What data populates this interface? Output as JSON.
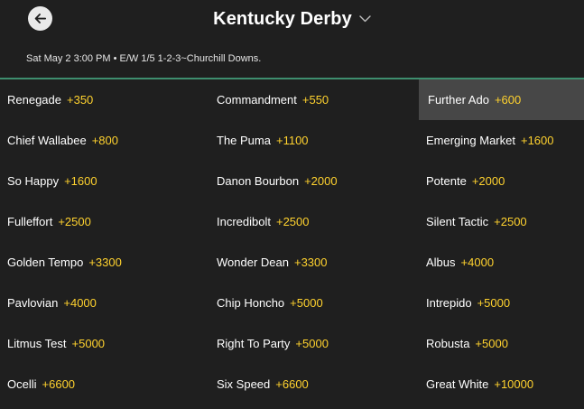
{
  "header": {
    "title": "Kentucky Derby",
    "subtitle": "Sat May 2 3:00 PM • E/W 1/5 1-2-3~Churchill Downs.",
    "back_icon": "arrow-left-icon",
    "dropdown_icon": "chevron-down-icon"
  },
  "colors": {
    "background": "#1f1f1f",
    "divider": "#3e8e6e",
    "odds": "#ffd22e",
    "selected_cell": "#474747"
  },
  "runners": [
    {
      "name": "Renegade",
      "odds": "+350"
    },
    {
      "name": "Commandment",
      "odds": "+550"
    },
    {
      "name": "Further Ado",
      "odds": "+600",
      "selected": true
    },
    {
      "name": "Chief Wallabee",
      "odds": "+800"
    },
    {
      "name": "The Puma",
      "odds": "+1100"
    },
    {
      "name": "Emerging Market",
      "odds": "+1600"
    },
    {
      "name": "So Happy",
      "odds": "+1600"
    },
    {
      "name": "Danon Bourbon",
      "odds": "+2000"
    },
    {
      "name": "Potente",
      "odds": "+2000"
    },
    {
      "name": "Fulleffort",
      "odds": "+2500"
    },
    {
      "name": "Incredibolt",
      "odds": "+2500"
    },
    {
      "name": "Silent Tactic",
      "odds": "+2500"
    },
    {
      "name": "Golden Tempo",
      "odds": "+3300"
    },
    {
      "name": "Wonder Dean",
      "odds": "+3300"
    },
    {
      "name": "Albus",
      "odds": "+4000"
    },
    {
      "name": "Pavlovian",
      "odds": "+4000"
    },
    {
      "name": "Chip Honcho",
      "odds": "+5000"
    },
    {
      "name": "Intrepido",
      "odds": "+5000"
    },
    {
      "name": "Litmus Test",
      "odds": "+5000"
    },
    {
      "name": "Right To Party",
      "odds": "+5000"
    },
    {
      "name": "Robusta",
      "odds": "+5000"
    },
    {
      "name": "Ocelli",
      "odds": "+6600"
    },
    {
      "name": "Six Speed",
      "odds": "+6600"
    },
    {
      "name": "Great White",
      "odds": "+10000"
    }
  ]
}
